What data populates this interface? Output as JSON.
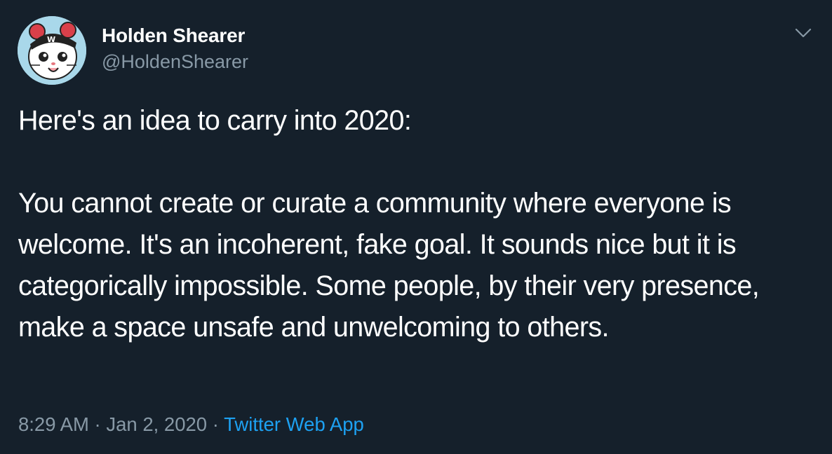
{
  "tweet": {
    "author": {
      "display_name": "Holden Shearer",
      "handle": "@HoldenShearer",
      "avatar_icon": "hamster-avatar-icon"
    },
    "menu_icon": "chevron-down-icon",
    "text_paragraphs": [
      "Here's an idea to carry into 2020:",
      "You cannot create or curate a community where everyone is welcome. It's an incoherent, fake goal. It sounds nice but it is categorically impossible. Some people, by their very presence, make a space unsafe and unwelcoming to others."
    ],
    "time": "8:29 AM",
    "separator": "·",
    "date": "Jan 2, 2020",
    "source": "Twitter Web App"
  },
  "colors": {
    "background": "#15202b",
    "text": "#ffffff",
    "secondary_text": "#8899a6",
    "link": "#1da1f2"
  }
}
